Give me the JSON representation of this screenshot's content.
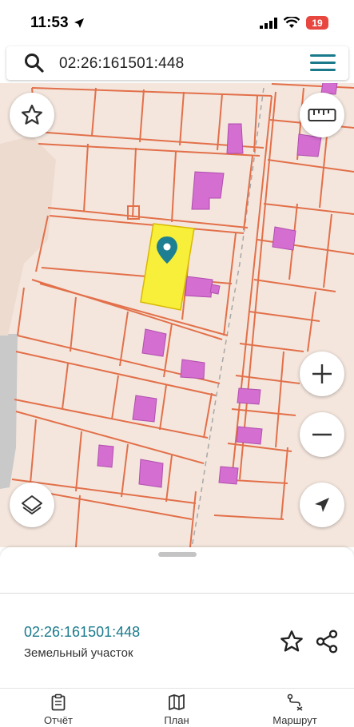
{
  "status_bar": {
    "time": "11:53",
    "battery": "19"
  },
  "search": {
    "query": "02:26:161501:448"
  },
  "map": {
    "colors": {
      "background": "#f4e6dd",
      "parcel_border": "#e2704a",
      "building": "#d46ed0",
      "selected_parcel": "#f7ef3a",
      "marker": "#1e7f93"
    },
    "buttons": [
      "star-icon",
      "ruler-icon",
      "zoom-in-icon",
      "zoom-out-icon",
      "layers-icon",
      "navigation-arrow-icon"
    ]
  },
  "sheet": {
    "cadastral_number": "02:26:161501:448",
    "object_type": "Земельный участок"
  },
  "nav": {
    "items": [
      {
        "label": "Отчёт",
        "icon": "clipboard-icon"
      },
      {
        "label": "План",
        "icon": "map-icon"
      },
      {
        "label": "Маршрут",
        "icon": "route-icon"
      }
    ]
  }
}
